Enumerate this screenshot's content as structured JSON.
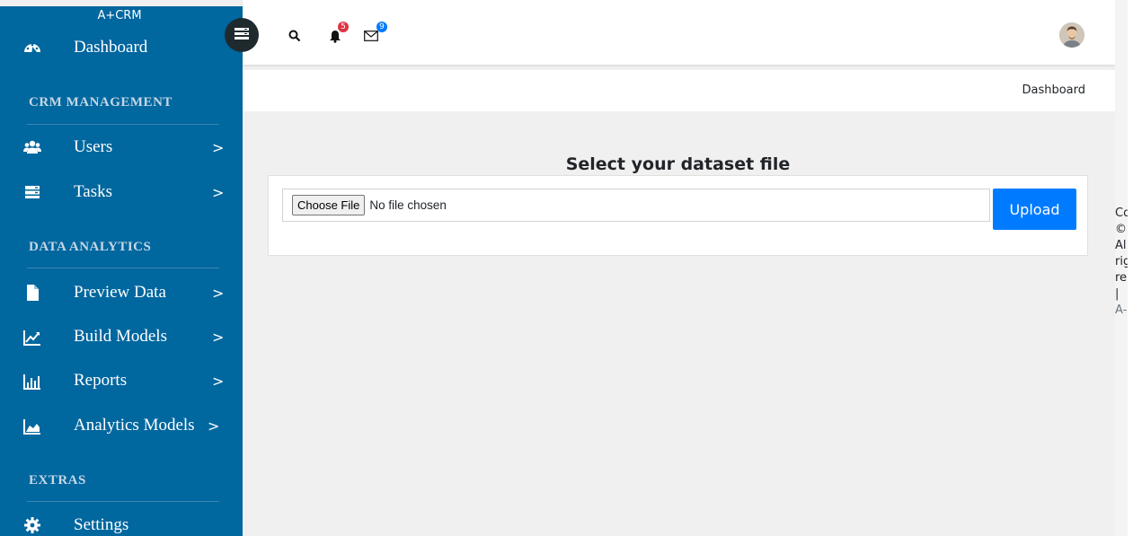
{
  "sidebar": {
    "brand": "A+CRM",
    "dashboard_label": "Dashboard",
    "sections": {
      "crm": "CRM MANAGEMENT",
      "analytics": "DATA ANALYTICS",
      "extras": "EXTRAS"
    },
    "items": {
      "users": "Users",
      "tasks": "Tasks",
      "preview": "Preview Data",
      "build": "Build Models",
      "reports": "Reports",
      "analytics_models": "Analytics Models",
      "settings": "Settings"
    },
    "chevron": ">"
  },
  "topbar": {
    "notifications_count": "5",
    "messages_count": "9"
  },
  "breadcrumb": {
    "current": "Dashboard"
  },
  "main": {
    "title": "Select your dataset file",
    "file_button": "Choose File",
    "file_status": "No file chosen",
    "upload_button": "Upload"
  },
  "footer": {
    "lines": [
      "Co",
      "©",
      "Al",
      "rig",
      "re",
      "|",
      "A-"
    ]
  },
  "colors": {
    "sidebar_bg": "#00679f",
    "primary": "#007bff",
    "notification_badge": "#dc3545",
    "message_badge": "#007bff"
  }
}
